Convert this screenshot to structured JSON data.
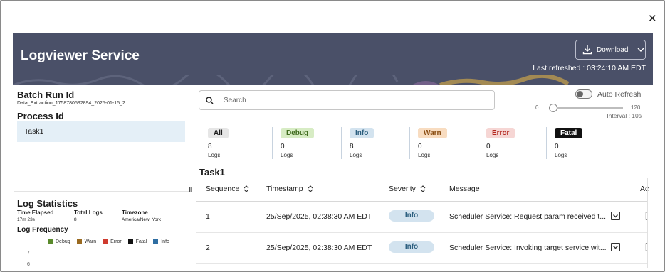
{
  "close_glyph": "✕",
  "header": {
    "title": "Logviewer Service",
    "download_label": "Download",
    "last_refreshed_label": "Last refreshed :",
    "last_refreshed_value": "03:24:10 AM EDT",
    "banner_color": "#4a5068"
  },
  "left_panel": {
    "batch_run_label": "Batch Run Id",
    "batch_run_value": "Data_Extraction_1758780592894_2025-01-15_2",
    "process_label": "Process Id",
    "process_items": [
      "Task1"
    ],
    "stats_title": "Log Statistics",
    "stats": [
      {
        "label": "Time Elapsed",
        "value": "17m 23s"
      },
      {
        "label": "Total Logs",
        "value": "8"
      },
      {
        "label": "Timezone",
        "value": "America/New_York"
      }
    ],
    "freq_title": "Log Frequency",
    "legend": [
      {
        "name": "Debug",
        "color": "#5a8a2c"
      },
      {
        "name": "Warn",
        "color": "#9a6a20"
      },
      {
        "name": "Error",
        "color": "#cf3a2e"
      },
      {
        "name": "Fatal",
        "color": "#111111"
      },
      {
        "name": "Info",
        "color": "#2f6ea2"
      }
    ],
    "y_ticks": [
      "7",
      "6"
    ]
  },
  "controls": {
    "search_placeholder": "Search",
    "auto_refresh_label": "Auto Refresh",
    "auto_refresh_on": false,
    "slider_min": "0",
    "slider_max": "120",
    "slider_value": 0,
    "interval_label": "Interval : 10s"
  },
  "severity": [
    {
      "name": "All",
      "count": "8",
      "unit": "Logs",
      "bg": "#e6e6e6",
      "fg": "#1c1c1c"
    },
    {
      "name": "Debug",
      "count": "0",
      "unit": "Logs",
      "bg": "#d7ecc4",
      "fg": "#3f6b1e"
    },
    {
      "name": "Info",
      "count": "8",
      "unit": "Logs",
      "bg": "#d3e3ef",
      "fg": "#2b5e7e"
    },
    {
      "name": "Warn",
      "count": "0",
      "unit": "Logs",
      "bg": "#f8dcc0",
      "fg": "#8a4d12"
    },
    {
      "name": "Error",
      "count": "0",
      "unit": "Logs",
      "bg": "#f6d6d4",
      "fg": "#b3261e"
    },
    {
      "name": "Fatal",
      "count": "0",
      "unit": "Logs",
      "bg": "#111111",
      "fg": "#ffffff"
    }
  ],
  "table": {
    "title": "Task1",
    "columns": [
      "Sequence",
      "Timestamp",
      "Severity",
      "Message",
      "Ac"
    ],
    "rows": [
      {
        "sequence": "1",
        "timestamp": "25/Sep/2025, 02:38:30 AM EDT",
        "severity": "Info",
        "message": "Scheduler Service: Request param received t..."
      },
      {
        "sequence": "2",
        "timestamp": "25/Sep/2025, 02:38:30 AM EDT",
        "severity": "Info",
        "message": "Scheduler Service: Invoking target service wit..."
      }
    ]
  }
}
